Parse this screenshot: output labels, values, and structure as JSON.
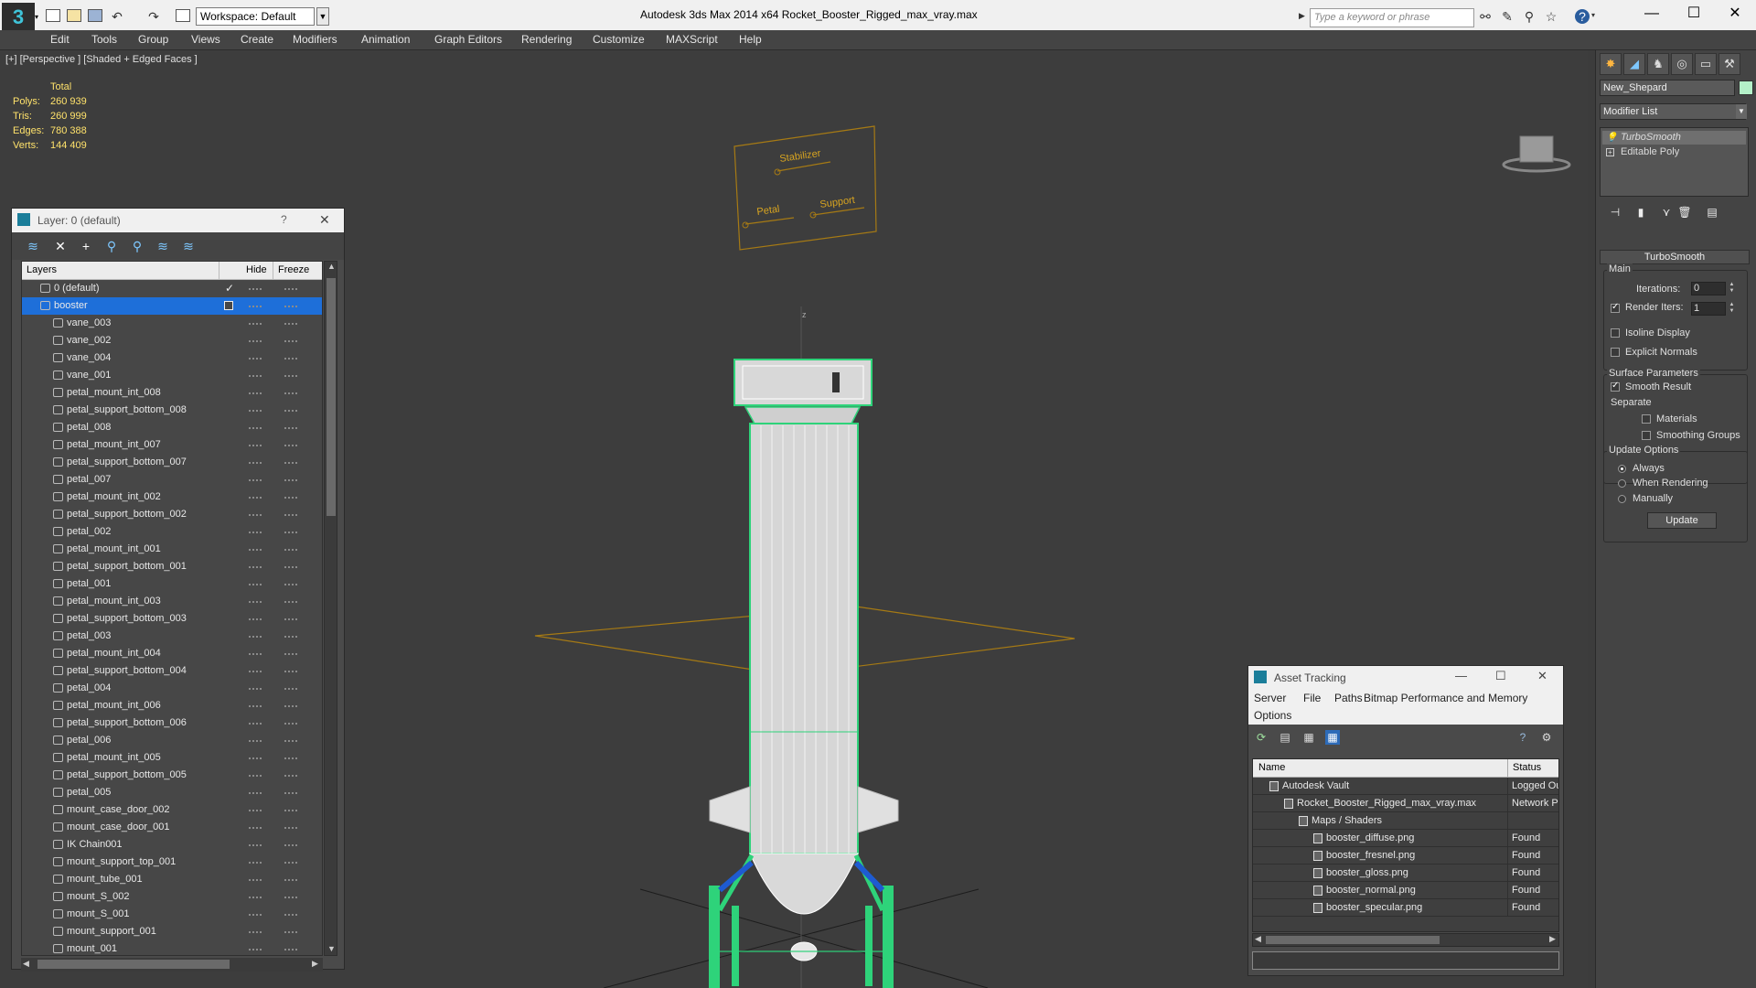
{
  "titlebar": {
    "workspace": "Workspace: Default",
    "app_title": "Autodesk 3ds Max  2014 x64      Rocket_Booster_Rigged_max_vray.max",
    "search_placeholder": "Type a keyword or phrase",
    "minimize": "—",
    "maximize": "☐",
    "close": "✕"
  },
  "menu": [
    "Edit",
    "Tools",
    "Group",
    "Views",
    "Create",
    "Modifiers",
    "Animation",
    "Graph Editors",
    "Rendering",
    "Customize",
    "MAXScript",
    "Help"
  ],
  "viewport": {
    "label": "[+] [Perspective ] [Shaded + Edged Faces ]",
    "stats": {
      "header": "Total",
      "polys_label": "Polys:",
      "polys": "260 939",
      "tris_label": "Tris:",
      "tris": "260 999",
      "edges_label": "Edges:",
      "edges": "780 388",
      "verts_label": "Verts:",
      "verts": "144 409"
    },
    "control_labels": [
      "Stabilizer",
      "Petal",
      "Support"
    ],
    "axis_label": "z"
  },
  "layer_dialog": {
    "title": "Layer: 0 (default)",
    "help": "?",
    "close": "✕",
    "columns": {
      "layers": "Layers",
      "hide": "Hide",
      "freeze": "Freeze"
    },
    "layers": [
      {
        "name": "0 (default)",
        "level": 0,
        "current": true
      },
      {
        "name": "booster",
        "level": 0,
        "selected": true
      },
      {
        "name": "vane_003",
        "level": 1
      },
      {
        "name": "vane_002",
        "level": 1
      },
      {
        "name": "vane_004",
        "level": 1
      },
      {
        "name": "vane_001",
        "level": 1
      },
      {
        "name": "petal_mount_int_008",
        "level": 1
      },
      {
        "name": "petal_support_bottom_008",
        "level": 1
      },
      {
        "name": "petal_008",
        "level": 1
      },
      {
        "name": "petal_mount_int_007",
        "level": 1
      },
      {
        "name": "petal_support_bottom_007",
        "level": 1
      },
      {
        "name": "petal_007",
        "level": 1
      },
      {
        "name": "petal_mount_int_002",
        "level": 1
      },
      {
        "name": "petal_support_bottom_002",
        "level": 1
      },
      {
        "name": "petal_002",
        "level": 1
      },
      {
        "name": "petal_mount_int_001",
        "level": 1
      },
      {
        "name": "petal_support_bottom_001",
        "level": 1
      },
      {
        "name": "petal_001",
        "level": 1
      },
      {
        "name": "petal_mount_int_003",
        "level": 1
      },
      {
        "name": "petal_support_bottom_003",
        "level": 1
      },
      {
        "name": "petal_003",
        "level": 1
      },
      {
        "name": "petal_mount_int_004",
        "level": 1
      },
      {
        "name": "petal_support_bottom_004",
        "level": 1
      },
      {
        "name": "petal_004",
        "level": 1
      },
      {
        "name": "petal_mount_int_006",
        "level": 1
      },
      {
        "name": "petal_support_bottom_006",
        "level": 1
      },
      {
        "name": "petal_006",
        "level": 1
      },
      {
        "name": "petal_mount_int_005",
        "level": 1
      },
      {
        "name": "petal_support_bottom_005",
        "level": 1
      },
      {
        "name": "petal_005",
        "level": 1
      },
      {
        "name": "mount_case_door_002",
        "level": 1
      },
      {
        "name": "mount_case_door_001",
        "level": 1
      },
      {
        "name": "IK Chain001",
        "level": 1
      },
      {
        "name": "mount_support_top_001",
        "level": 1
      },
      {
        "name": "mount_tube_001",
        "level": 1
      },
      {
        "name": "mount_S_002",
        "level": 1
      },
      {
        "name": "mount_S_001",
        "level": 1
      },
      {
        "name": "mount_support_001",
        "level": 1
      },
      {
        "name": "mount_001",
        "level": 1
      }
    ]
  },
  "command_panel": {
    "object_name": "New_Shepard",
    "object_color": "#b4f0c8",
    "modifier_list": "Modifier List",
    "stack": [
      "TurboSmooth",
      "Editable Poly"
    ],
    "rollout_title": "TurboSmooth",
    "main_label": "Main",
    "iterations_label": "Iterations:",
    "iterations": "0",
    "render_iters_label": "Render Iters:",
    "render_iters": "1",
    "isoline": "Isoline Display",
    "explicit_normals": "Explicit Normals",
    "surface_params": "Surface Parameters",
    "smooth_result": "Smooth Result",
    "separate": "Separate",
    "materials": "Materials",
    "smoothing_groups": "Smoothing Groups",
    "update_options": "Update Options",
    "always": "Always",
    "when_rendering": "When Rendering",
    "manually": "Manually",
    "update_button": "Update"
  },
  "asset_tracking": {
    "title": "Asset Tracking",
    "menu": [
      "Server",
      "File",
      "Paths",
      "Bitmap Performance and Memory",
      "Options"
    ],
    "columns": {
      "name": "Name",
      "status": "Status"
    },
    "rows": [
      {
        "name": "Autodesk Vault",
        "status": "Logged Out",
        "indent": 1
      },
      {
        "name": "Rocket_Booster_Rigged_max_vray.max",
        "status": "Network Path",
        "indent": 2
      },
      {
        "name": "Maps / Shaders",
        "status": "",
        "indent": 3
      },
      {
        "name": "booster_diffuse.png",
        "status": "Found",
        "indent": 4
      },
      {
        "name": "booster_fresnel.png",
        "status": "Found",
        "indent": 4
      },
      {
        "name": "booster_gloss.png",
        "status": "Found",
        "indent": 4
      },
      {
        "name": "booster_normal.png",
        "status": "Found",
        "indent": 4
      },
      {
        "name": "booster_specular.png",
        "status": "Found",
        "indent": 4
      }
    ]
  },
  "colors": {
    "selection": "#1e6fd9",
    "wire_green": "#2ed37a",
    "stats_yellow": "#ffe26b"
  }
}
